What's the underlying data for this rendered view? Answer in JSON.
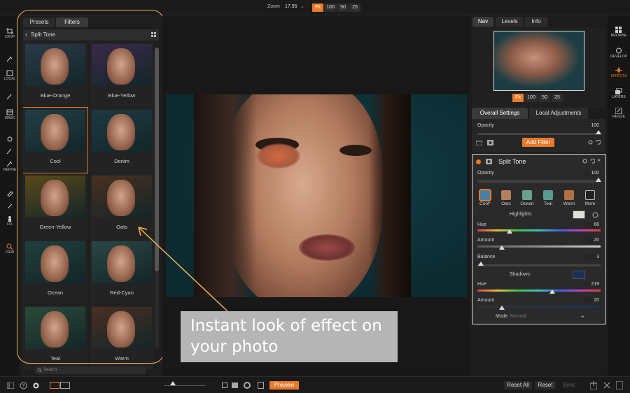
{
  "topbar": {
    "zoom_label": "Zoom",
    "zoom_value": "17.95",
    "zoom_buttons": [
      "Fit",
      "100",
      "50",
      "25"
    ]
  },
  "left_tools": [
    "CROP",
    "LOCAL",
    "MASK",
    "REFINE",
    "FIX",
    "VIEW"
  ],
  "preset_panel": {
    "tabs": [
      "Presets",
      "Filters"
    ],
    "breadcrumb": "Split Tone",
    "presets": [
      {
        "label": "Blue-Orange",
        "tint": "#2a3a4a"
      },
      {
        "label": "Blue-Yellow",
        "tint": "#3a2a4a"
      },
      {
        "label": "Cool",
        "tint": "#213f47"
      },
      {
        "label": "Denim",
        "tint": "#1e3a44"
      },
      {
        "label": "Green-Yellow",
        "tint": "#5a4a1a"
      },
      {
        "label": "Oats",
        "tint": "#4a3020"
      },
      {
        "label": "Ocean",
        "tint": "#1f3f3c"
      },
      {
        "label": "Red-Cyan",
        "tint": "#2a4744"
      },
      {
        "label": "Teal",
        "tint": "#2a4a3a"
      },
      {
        "label": "Warm",
        "tint": "#4a2f22"
      }
    ],
    "search_placeholder": "Search"
  },
  "callout": {
    "line1": "Instant look of effect on",
    "line2": "your photo"
  },
  "nav_panel": {
    "tabs": [
      "Nav",
      "Levels",
      "Info"
    ],
    "zoom_buttons": [
      "Fit",
      "100",
      "50",
      "25"
    ]
  },
  "settings_tabs": [
    "Overall Settings",
    "Local Adjustments"
  ],
  "overall": {
    "opacity_label": "Opacity",
    "opacity_value": "100",
    "add_filter": "Add Filter"
  },
  "filter": {
    "title": "Split Tone",
    "opacity_label": "Opacity",
    "opacity_value": "100",
    "styles": [
      {
        "label": "Cool*",
        "color": "#4a7fa0"
      },
      {
        "label": "Oats",
        "color": "#b08060"
      },
      {
        "label": "Ocean",
        "color": "#6aa090"
      },
      {
        "label": "Teal",
        "color": "#5a9a90"
      },
      {
        "label": "Warm",
        "color": "#b07040"
      },
      {
        "label": "More",
        "color": "#222222"
      }
    ],
    "highlights_label": "Highlights:",
    "highlight_color": "#dfe2d2",
    "hue_label": "Hue",
    "hue_value": "66",
    "hue_level": 0.26,
    "amount_label": "Amount",
    "amount_value": "20",
    "amount_level": 0.2,
    "balance_label": "Balance",
    "balance_value": "3",
    "balance_level": 0.03,
    "shadows_label": "Shadows:",
    "shadow_color": "#17315a",
    "shadow_hue_label": "Hue",
    "shadow_hue_value": "219",
    "shadow_hue_level": 0.61,
    "shadow_amount_label": "Amount",
    "shadow_amount_value": "20",
    "shadow_amount_level": 0.2,
    "mode_label": "Mode",
    "mode_value": "Normal"
  },
  "right_tools": [
    "BROWSE",
    "DEVELOP",
    "EFFECTS",
    "LAYERS",
    "RESIZE"
  ],
  "bottombar": {
    "preview": "Preview",
    "reset_all": "Reset All",
    "reset": "Reset",
    "sync": "Sync"
  },
  "colors": {
    "accent": "#e87a2c",
    "highlight_frame": "#f3b54a"
  }
}
